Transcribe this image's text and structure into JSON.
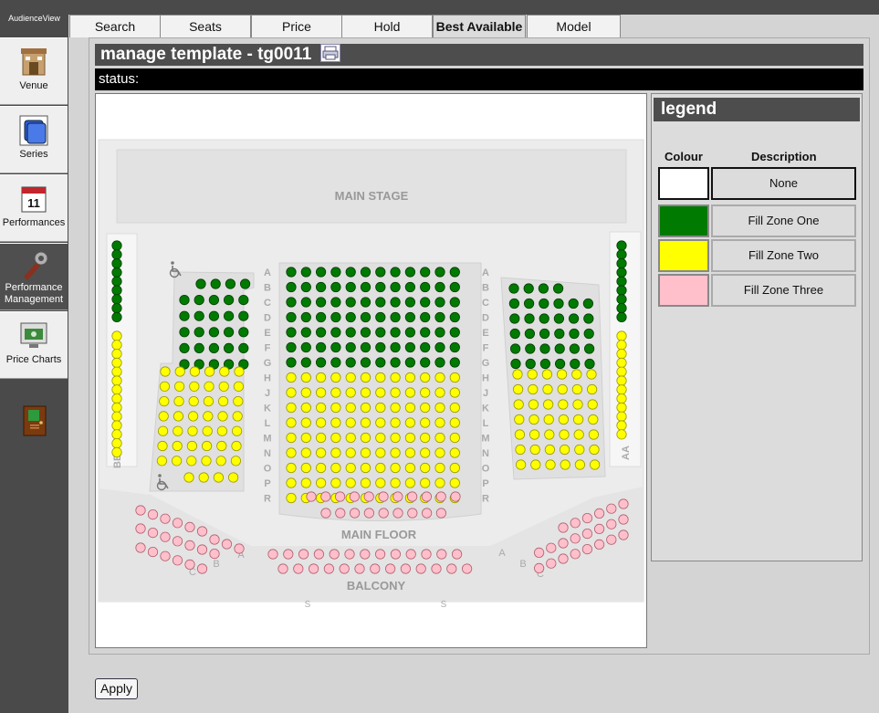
{
  "app": {
    "brand": "AudienceView"
  },
  "sidebar": {
    "items": [
      {
        "label": "Venue",
        "icon": "venue-icon"
      },
      {
        "label": "Series",
        "icon": "series-icon"
      },
      {
        "label": "Performances",
        "icon": "calendar-icon"
      },
      {
        "label": "Performance Management",
        "icon": "wrench-icon"
      },
      {
        "label": "Price Charts",
        "icon": "price-chart-icon"
      }
    ],
    "active_index": 3,
    "exit_icon": "exit-door-icon"
  },
  "tabs": [
    {
      "label": "Search"
    },
    {
      "label": "Seats"
    },
    {
      "label": "Price"
    },
    {
      "label": "Hold"
    },
    {
      "label": "Best Available",
      "active": true
    },
    {
      "label": "Model"
    }
  ],
  "header": {
    "title": "manage template - tg0011",
    "print_icon": "print-icon"
  },
  "status": {
    "label": "status:"
  },
  "seatmap": {
    "stage_label": "MAIN STAGE",
    "floor_label": "MAIN FLOOR",
    "balcony_label": "BALCONY",
    "left_side_label": "BB",
    "right_side_label": "AA",
    "row_labels": [
      "A",
      "B",
      "C",
      "D",
      "E",
      "F",
      "G",
      "H",
      "J",
      "K",
      "L",
      "M",
      "N",
      "O",
      "P",
      "R"
    ],
    "front_row_label": "S",
    "wing_row_labels": [
      "A",
      "B",
      "C"
    ],
    "accessible_icon": "wheelchair-icon"
  },
  "legend": {
    "title": "legend",
    "colour_header": "Colour",
    "description_header": "Description",
    "items": [
      {
        "color": "#ffffff",
        "description": "None"
      },
      {
        "color": "#007a00",
        "description": "Fill Zone One"
      },
      {
        "color": "#ffff00",
        "description": "Fill Zone Two"
      },
      {
        "color": "#ffc0cb",
        "description": "Fill Zone Three"
      }
    ]
  },
  "colors": {
    "zone_one": "#007a00",
    "zone_two": "#ffff00",
    "zone_three": "#ffc0cb",
    "none": "#ffffff"
  },
  "footer": {
    "apply_label": "Apply"
  }
}
